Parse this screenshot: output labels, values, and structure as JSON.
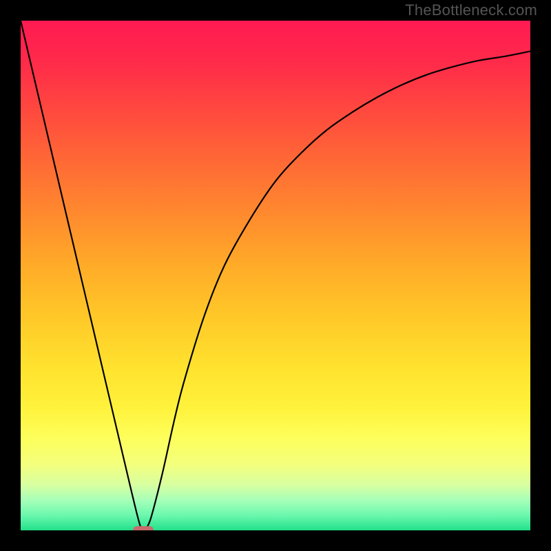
{
  "watermark": "TheBottleneck.com",
  "colors": {
    "frame_bg": "#000000",
    "marker": "#c96a6c",
    "curve": "#000000",
    "gradient_top": "#ff1a52",
    "gradient_bottom": "#22e08a"
  },
  "chart_data": {
    "type": "line",
    "title": "",
    "xlabel": "",
    "ylabel": "",
    "xlim": [
      0,
      100
    ],
    "ylim": [
      0,
      100
    ],
    "grid": false,
    "x": [
      0,
      4,
      8,
      12,
      16,
      20,
      23,
      24,
      25,
      26,
      28,
      30,
      32,
      36,
      40,
      45,
      50,
      55,
      60,
      65,
      70,
      75,
      80,
      85,
      90,
      95,
      100
    ],
    "values": [
      100,
      83,
      66,
      49,
      32,
      15,
      2.5,
      0,
      1,
      4,
      12,
      21,
      29,
      42,
      52,
      61,
      68.5,
      74,
      78.5,
      82,
      85,
      87.5,
      89.5,
      91,
      92.2,
      93,
      94
    ],
    "minimum": {
      "x": 24,
      "y": 0
    },
    "annotations": []
  },
  "marker": {
    "x_pct": 24,
    "y_pct": 0
  }
}
